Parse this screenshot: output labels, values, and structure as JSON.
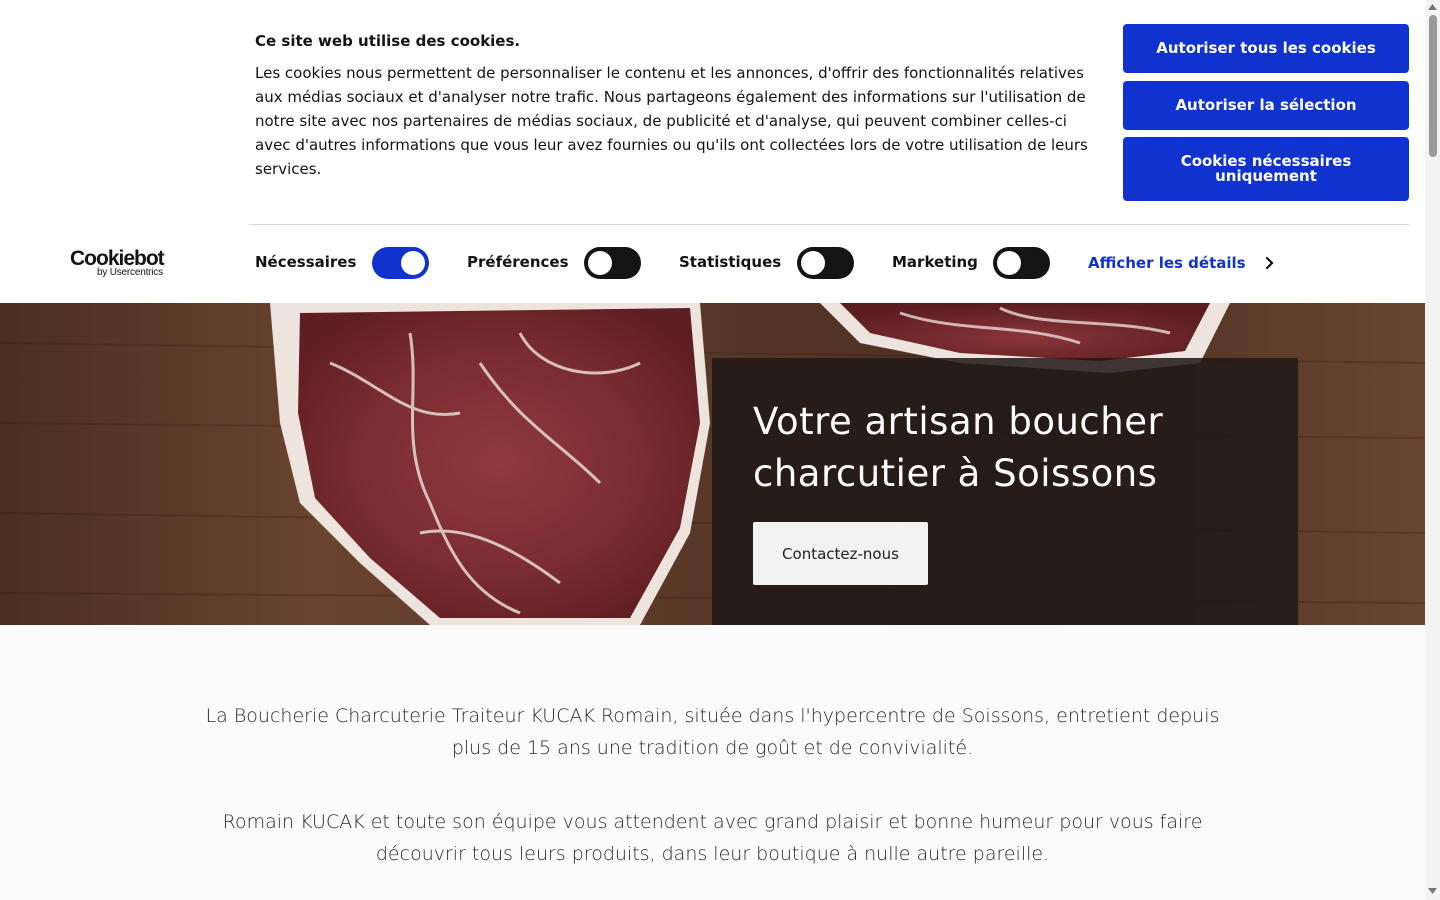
{
  "cookie_banner": {
    "title": "Ce site web utilise des cookies.",
    "text": "Les cookies nous permettent de personnaliser le contenu et les annonces, d'offrir des fonctionnalités relatives aux médias sociaux et d'analyser notre trafic. Nous partageons également des informations sur l'utilisation de notre site avec nos partenaires de médias sociaux, de publicité et d'analyse, qui peuvent combiner celles-ci avec d'autres informations que vous leur avez fournies ou qu'ils ont collectées lors de votre utilisation de leurs services.",
    "buttons": {
      "allow_all": "Autoriser tous les cookies",
      "allow_selection": "Autoriser la sélection",
      "necessary_only": "Cookies nécessaires uniquement"
    },
    "logo": {
      "main": "Cookiebot",
      "sub": "by Usercentrics"
    },
    "consents": [
      {
        "label": "Nécessaires",
        "enabled": true
      },
      {
        "label": "Préférences",
        "enabled": false
      },
      {
        "label": "Statistiques",
        "enabled": false
      },
      {
        "label": "Marketing",
        "enabled": false
      }
    ],
    "details_link": "Afficher les détails",
    "accent_color": "#1032cf"
  },
  "hero": {
    "title": "Votre artisan boucher charcutier à Soissons",
    "cta": "Contactez-nous"
  },
  "intro": {
    "paragraph_1": "La Boucherie Charcuterie Traiteur KUCAK Romain, située dans l'hypercentre de Soissons, entretient depuis plus de 15 ans une tradition de goût et de convivialité.",
    "paragraph_2": "Romain KUCAK et toute son équipe vous attendent avec grand plaisir et bonne humeur pour vous faire découvrir tous leurs produits, dans leur boutique à nulle autre pareille."
  }
}
